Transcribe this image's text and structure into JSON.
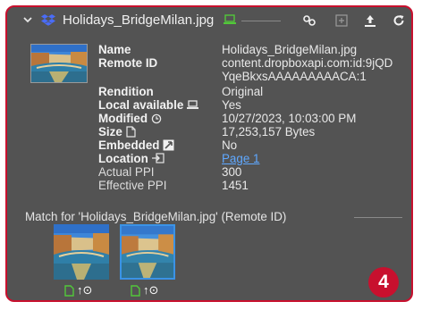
{
  "header": {
    "title": "Holidays_BridgeMilan.jpg",
    "icons": [
      "chevron-down-icon",
      "dropbox-icon",
      "laptop-icon",
      "link-icon",
      "add-icon",
      "upload-icon",
      "refresh-icon"
    ]
  },
  "details": {
    "name_label": "Name",
    "name_value": "Holidays_BridgeMilan.jpg",
    "remote_id_label": "Remote ID",
    "remote_id_value_1": "content.dropboxapi.com:id:9jQD",
    "remote_id_value_2": "YqeBkxsAAAAAAAAACA:1",
    "rendition_label": "Rendition",
    "rendition_value": "Original",
    "local_available_label": "Local available",
    "local_available_value": "Yes",
    "modified_label": "Modified",
    "modified_value": "10/27/2023, 10:03:00 PM",
    "size_label": "Size",
    "size_value": "17,253,157 Bytes",
    "embedded_label": "Embedded",
    "embedded_value": "No",
    "location_label": "Location",
    "location_value": "Page 1",
    "actual_ppi_label": "Actual PPI",
    "actual_ppi_value": "300",
    "effective_ppi_label": "Effective PPI",
    "effective_ppi_value": "1451"
  },
  "match": {
    "text": "Match for 'Holidays_BridgeMilan.jpg' (Remote ID)",
    "results": [
      {
        "selected": false,
        "icon_text": "↑⊙"
      },
      {
        "selected": true,
        "icon_text": "↑⊙"
      }
    ]
  },
  "badge": "4",
  "colors": {
    "panel_bg": "#535353",
    "border_accent": "#c8102e",
    "link": "#5fa8ff",
    "selection": "#3b93e6",
    "green_icon": "#52c83a",
    "dropbox_blue": "#4a6cf7"
  }
}
